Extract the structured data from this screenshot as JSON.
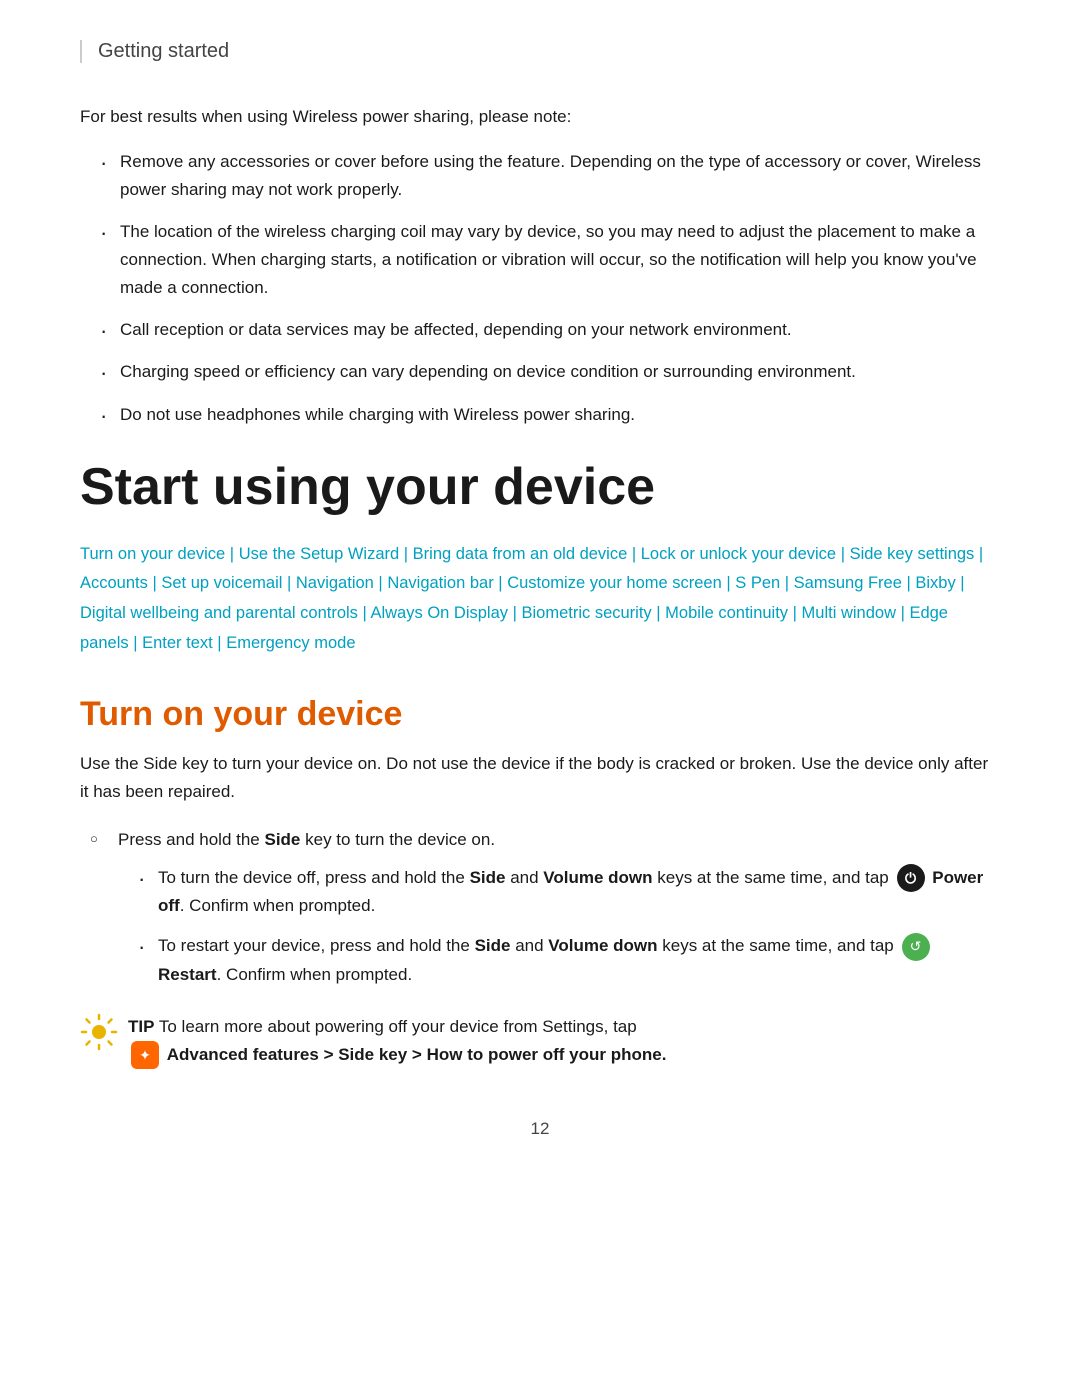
{
  "page": {
    "header": "Getting started",
    "page_number": "12"
  },
  "intro": {
    "paragraph": "For best results when using Wireless power sharing, please note:",
    "bullets": [
      "Remove any accessories or cover before using the feature. Depending on the type of accessory or cover, Wireless power sharing may not work properly.",
      "The location of the wireless charging coil may vary by device, so you may need to adjust the placement to make a connection. When charging starts, a notification or vibration will occur, so the notification will help you know you've made a connection.",
      "Call reception or data services may be affected, depending on your network environment.",
      "Charging speed or efficiency can vary depending on device condition or surrounding environment.",
      "Do not use headphones while charging with Wireless power sharing."
    ]
  },
  "main_section": {
    "title": "Start using your device",
    "nav_links": [
      "Turn on your device",
      "Use the Setup Wizard",
      "Bring data from an old device",
      "Lock or unlock your device",
      "Side key settings",
      "Accounts",
      "Set up voicemail",
      "Navigation",
      "Navigation bar",
      "Customize your home screen",
      "S Pen",
      "Samsung Free",
      "Bixby",
      "Digital wellbeing and parental controls",
      "Always On Display",
      "Biometric security",
      "Mobile continuity",
      "Multi window",
      "Edge panels",
      "Enter text",
      "Emergency mode"
    ]
  },
  "subsection": {
    "title": "Turn on your device",
    "body": "Use the Side key to turn your device on. Do not use the device if the body is cracked or broken. Use the device only after it has been repaired.",
    "circle_bullet": "Press and hold the Side key to turn the device on.",
    "sub_bullets": [
      {
        "text_start": "To turn the device off, press and hold the ",
        "bold1": "Side",
        "text_mid1": " and ",
        "bold2": "Volume down",
        "text_mid2": " keys at the same time, and tap",
        "icon": "power",
        "bold3": "Power off",
        "text_end": ". Confirm when prompted."
      },
      {
        "text_start": "To restart your device, press and hold the ",
        "bold1": "Side",
        "text_mid1": " and ",
        "bold2": "Volume down",
        "text_mid2": " keys at the same time, and tap",
        "icon": "restart",
        "bold3": "Restart",
        "text_end": ". Confirm when prompted."
      }
    ],
    "tip": {
      "label": "TIP",
      "text": "To learn more about powering off your device from Settings, tap",
      "bold": "Advanced features > Side key > How to power off your phone."
    }
  }
}
